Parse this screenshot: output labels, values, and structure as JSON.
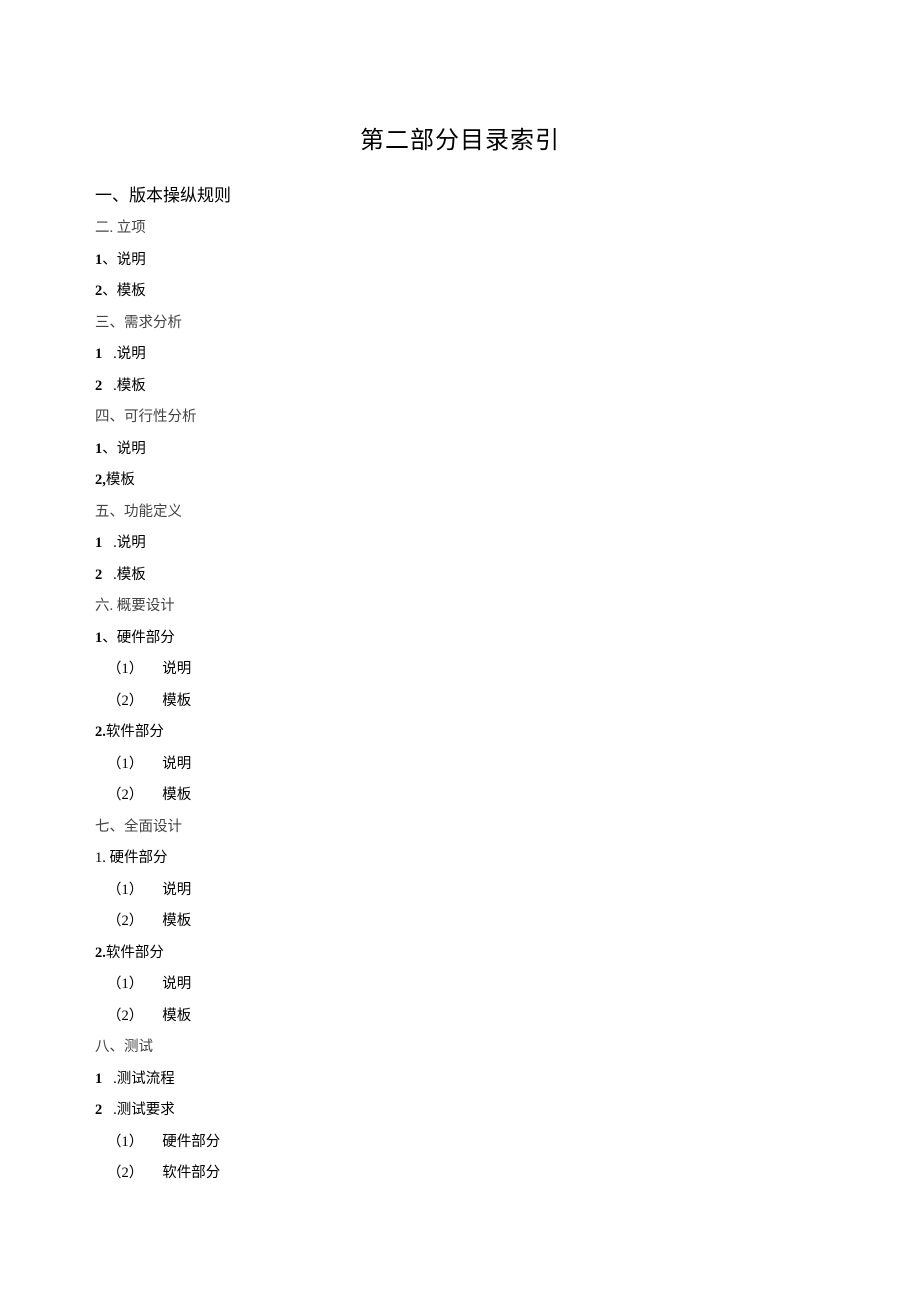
{
  "title": "第二部分目录索引",
  "items": [
    {
      "text": "一、版本操纵规则",
      "cls": "level-0 heading-main"
    },
    {
      "text": "二. 立项",
      "cls": "level-0 light-text"
    },
    {
      "html": "<span class='bold-num'>1</span>、说明",
      "cls": "level-0"
    },
    {
      "html": "<span class='bold-num'>2</span>、模板",
      "cls": "level-0"
    },
    {
      "text": "三、需求分析",
      "cls": "level-0 light-text"
    },
    {
      "html": "<span class='bold-num'>1</span>&nbsp;&nbsp;&nbsp;.说明",
      "cls": "level-0"
    },
    {
      "html": "<span class='bold-num'>2</span>&nbsp;&nbsp;&nbsp;.模板",
      "cls": "level-0"
    },
    {
      "text": "四、可行性分析",
      "cls": "level-0 light-text"
    },
    {
      "html": "<span class='bold-num'>1</span>、说明",
      "cls": "level-0"
    },
    {
      "html": "<span class='bold-num'>2,</span>模板",
      "cls": "level-0"
    },
    {
      "text": "五、功能定义",
      "cls": "level-0 light-text"
    },
    {
      "html": "<span class='bold-num'>1</span>&nbsp;&nbsp;&nbsp;.说明",
      "cls": "level-0"
    },
    {
      "html": "<span class='bold-num'>2</span>&nbsp;&nbsp;&nbsp;.模板",
      "cls": "level-0"
    },
    {
      "text": "六. 概要设计",
      "cls": "level-0 light-text"
    },
    {
      "html": "<span class='bold-num'>1</span>、硬件部分",
      "cls": "level-0"
    },
    {
      "html": "<span class='paren-label'>（1）</span>&nbsp;&nbsp;说明",
      "cls": "level-2"
    },
    {
      "html": "<span class='paren-label'>（2）</span>&nbsp;&nbsp;模板",
      "cls": "level-2"
    },
    {
      "html": "<span class='bold-num'>2.</span>软件部分",
      "cls": "level-0"
    },
    {
      "html": "<span class='paren-label'>（1）</span>&nbsp;&nbsp;说明",
      "cls": "level-2"
    },
    {
      "html": "<span class='paren-label'>（2）</span>&nbsp;&nbsp;模板",
      "cls": "level-2"
    },
    {
      "text": "七、全面设计",
      "cls": "level-0 light-text"
    },
    {
      "text": "1. 硬件部分",
      "cls": "level-0"
    },
    {
      "html": "<span class='paren-label'>（1）</span>&nbsp;&nbsp;说明",
      "cls": "level-2"
    },
    {
      "html": "<span class='paren-label'>（2）</span>&nbsp;&nbsp;模板",
      "cls": "level-2"
    },
    {
      "html": "<span class='bold-num'>2.</span>软件部分",
      "cls": "level-0"
    },
    {
      "html": "<span class='paren-label'>（1）</span>&nbsp;&nbsp;说明",
      "cls": "level-2"
    },
    {
      "html": "<span class='paren-label'>（2）</span>&nbsp;&nbsp;模板",
      "cls": "level-2"
    },
    {
      "text": "八、测试",
      "cls": "level-0 light-text"
    },
    {
      "html": "<span class='bold-num'>1</span>&nbsp;&nbsp;&nbsp;.测试流程",
      "cls": "level-0"
    },
    {
      "html": "<span class='bold-num'>2</span>&nbsp;&nbsp;&nbsp;.测试要求",
      "cls": "level-0"
    },
    {
      "html": "<span class='paren-label'>（1）</span>&nbsp;&nbsp;硬件部分",
      "cls": "level-2"
    },
    {
      "html": "<span class='paren-label'>（2）</span>&nbsp;&nbsp;软件部分",
      "cls": "level-2"
    }
  ]
}
